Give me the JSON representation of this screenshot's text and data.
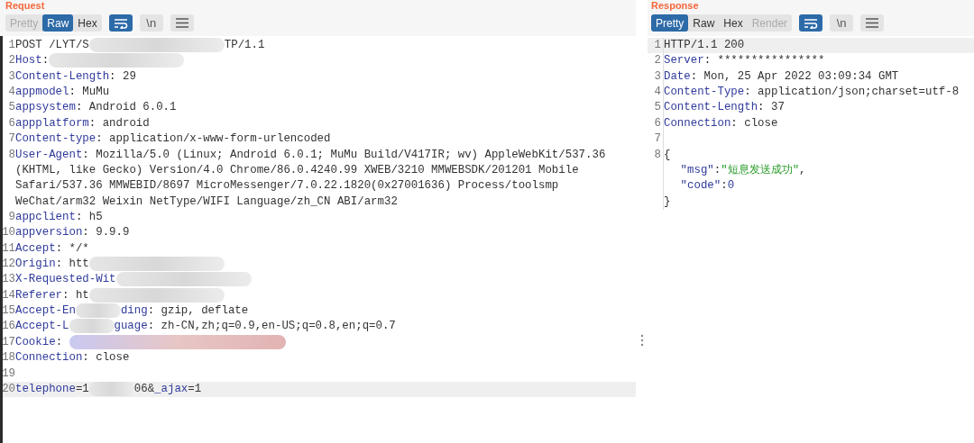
{
  "request": {
    "title": "Request",
    "tabs": [
      {
        "label": "Pretty",
        "selected": false,
        "disabled": true
      },
      {
        "label": "Raw",
        "selected": true,
        "disabled": false
      },
      {
        "label": "Hex",
        "selected": false,
        "disabled": false
      }
    ],
    "tools": [
      {
        "kind": "wrap",
        "on": true
      },
      {
        "kind": "newline",
        "label": "\\n",
        "on": false
      },
      {
        "kind": "menu",
        "on": false
      }
    ],
    "lines": [
      {
        "number": "1",
        "highlighted": false,
        "segments": [
          {
            "kind": "value",
            "text": "POST /LYT/S"
          },
          {
            "kind": "redacted"
          },
          {
            "kind": "value",
            "text": "TP/1.1"
          }
        ]
      },
      {
        "number": "2",
        "highlighted": false,
        "segments": [
          {
            "kind": "key",
            "text": "Host"
          },
          {
            "kind": "value",
            "text": ":"
          },
          {
            "kind": "redacted"
          }
        ]
      },
      {
        "number": "3",
        "highlighted": false,
        "segments": [
          {
            "kind": "key",
            "text": "Content-Length"
          },
          {
            "kind": "value",
            "text": ": 29"
          }
        ]
      },
      {
        "number": "4",
        "highlighted": false,
        "segments": [
          {
            "kind": "key",
            "text": "appmodel"
          },
          {
            "kind": "value",
            "text": ": MuMu"
          }
        ]
      },
      {
        "number": "5",
        "highlighted": false,
        "segments": [
          {
            "kind": "key",
            "text": "appsystem"
          },
          {
            "kind": "value",
            "text": ": Android 6.0.1"
          }
        ]
      },
      {
        "number": "6",
        "highlighted": false,
        "segments": [
          {
            "kind": "key",
            "text": "appplatform"
          },
          {
            "kind": "value",
            "text": ": android"
          }
        ]
      },
      {
        "number": "7",
        "highlighted": false,
        "segments": [
          {
            "kind": "key",
            "text": "Content-type"
          },
          {
            "kind": "value",
            "text": ": application/x-www-form-urlencoded"
          }
        ]
      },
      {
        "number": "8",
        "highlighted": false,
        "segments": [
          {
            "kind": "key",
            "text": "User-Agent"
          },
          {
            "kind": "value",
            "text": ": Mozilla/5.0 (Linux; Android 6.0.1; MuMu Build/V417IR; wv) AppleWebKit/537.36"
          }
        ]
      },
      {
        "highlighted": false,
        "segments": [
          {
            "kind": "value",
            "text": "(KHTML, like Gecko) Version/4.0 Chrome/86.0.4240.99 XWEB/3210 MMWEBSDK/201201 Mobile"
          }
        ]
      },
      {
        "highlighted": false,
        "segments": [
          {
            "kind": "value",
            "text": "Safari/537.36 MMWEBID/8697 MicroMessenger/7.0.22.1820(0x27001636) Process/toolsmp"
          }
        ]
      },
      {
        "highlighted": false,
        "segments": [
          {
            "kind": "value",
            "text": "WeChat/arm32 Weixin NetType/WIFI Language/zh_CN ABI/arm32"
          }
        ]
      },
      {
        "number": "9",
        "highlighted": false,
        "segments": [
          {
            "kind": "key",
            "text": "appclient"
          },
          {
            "kind": "value",
            "text": ": h5"
          }
        ]
      },
      {
        "number": "10",
        "highlighted": false,
        "segments": [
          {
            "kind": "key",
            "text": "appversion"
          },
          {
            "kind": "value",
            "text": ": 9.9.9"
          }
        ]
      },
      {
        "number": "11",
        "highlighted": false,
        "segments": [
          {
            "kind": "key",
            "text": "Accept"
          },
          {
            "kind": "value",
            "text": ": */*"
          }
        ]
      },
      {
        "number": "12",
        "highlighted": false,
        "segments": [
          {
            "kind": "key",
            "text": "Origin"
          },
          {
            "kind": "value",
            "text": ": htt"
          },
          {
            "kind": "redacted"
          }
        ]
      },
      {
        "number": "13",
        "highlighted": false,
        "segments": [
          {
            "kind": "key",
            "text": "X-Requested-Wit"
          },
          {
            "kind": "redacted"
          }
        ]
      },
      {
        "number": "14",
        "highlighted": false,
        "segments": [
          {
            "kind": "key",
            "text": "Referer"
          },
          {
            "kind": "value",
            "text": ": ht"
          },
          {
            "kind": "redacted"
          }
        ]
      },
      {
        "number": "15",
        "highlighted": false,
        "segments": [
          {
            "kind": "key",
            "text": "Accept-En"
          },
          {
            "kind": "redacted-short"
          },
          {
            "kind": "key",
            "text": "ding"
          },
          {
            "kind": "value",
            "text": ": gzip, deflate"
          }
        ]
      },
      {
        "number": "16",
        "highlighted": false,
        "segments": [
          {
            "kind": "key",
            "text": "Accept-L"
          },
          {
            "kind": "redacted-short"
          },
          {
            "kind": "key",
            "text": "guage"
          },
          {
            "kind": "value",
            "text": ": zh-CN,zh;q=0.9,en-US;q=0.8,en;q=0.7"
          }
        ]
      },
      {
        "number": "17",
        "highlighted": false,
        "segments": [
          {
            "kind": "key",
            "text": "Cookie"
          },
          {
            "kind": "value",
            "text": ": "
          },
          {
            "kind": "redacted-long"
          }
        ]
      },
      {
        "number": "18",
        "highlighted": false,
        "segments": [
          {
            "kind": "key",
            "text": "Connection"
          },
          {
            "kind": "value",
            "text": ": close"
          }
        ]
      },
      {
        "number": "19",
        "highlighted": false
      },
      {
        "number": "20",
        "highlighted": true,
        "segments": [
          {
            "kind": "key",
            "text": "telephone"
          },
          {
            "kind": "value",
            "text": "=1"
          },
          {
            "kind": "redacted-short"
          },
          {
            "kind": "value",
            "text": "06&"
          },
          {
            "kind": "key",
            "text": "_ajax"
          },
          {
            "kind": "value",
            "text": "=1"
          }
        ]
      }
    ]
  },
  "response": {
    "title": "Response",
    "tabs": [
      {
        "label": "Pretty",
        "selected": true,
        "disabled": false
      },
      {
        "label": "Raw",
        "selected": false,
        "disabled": false
      },
      {
        "label": "Hex",
        "selected": false,
        "disabled": false
      },
      {
        "label": "Render",
        "selected": false,
        "disabled": true
      }
    ],
    "tools": [
      {
        "kind": "wrap",
        "on": true
      },
      {
        "kind": "newline",
        "label": "\\n",
        "on": false
      },
      {
        "kind": "menu",
        "on": false
      }
    ],
    "lines": [
      {
        "number": "1",
        "highlighted": true,
        "segments": [
          {
            "kind": "value",
            "text": "HTTP/1.1 200"
          }
        ]
      },
      {
        "number": "2",
        "highlighted": false,
        "segments": [
          {
            "kind": "key",
            "text": "Server"
          },
          {
            "kind": "value",
            "text": ": ****************"
          }
        ]
      },
      {
        "number": "3",
        "highlighted": false,
        "segments": [
          {
            "kind": "key",
            "text": "Date"
          },
          {
            "kind": "value",
            "text": ": Mon, 25 Apr 2022 03:09:34 GMT"
          }
        ]
      },
      {
        "number": "4",
        "highlighted": false,
        "segments": [
          {
            "kind": "key",
            "text": "Content-Type"
          },
          {
            "kind": "value",
            "text": ": application/json;charset=utf-8"
          }
        ]
      },
      {
        "number": "5",
        "highlighted": false,
        "segments": [
          {
            "kind": "key",
            "text": "Content-Length"
          },
          {
            "kind": "value",
            "text": ": 37"
          }
        ]
      },
      {
        "number": "6",
        "highlighted": false,
        "segments": [
          {
            "kind": "key",
            "text": "Connection"
          },
          {
            "kind": "value",
            "text": ": close"
          }
        ]
      },
      {
        "number": "7",
        "highlighted": false
      },
      {
        "number": "8",
        "highlighted": false,
        "segments": [
          {
            "kind": "value",
            "text": "{"
          }
        ],
        "children": [
          {
            "highlighted": false,
            "segments": [
              {
                "kind": "key",
                "text": "\"msg\""
              },
              {
                "kind": "value",
                "text": ":"
              },
              {
                "kind": "string",
                "text": "\"短息发送成功\""
              },
              {
                "kind": "value",
                "text": ","
              }
            ]
          },
          {
            "highlighted": false,
            "segments": [
              {
                "kind": "key",
                "text": "\"code\""
              },
              {
                "kind": "value",
                "text": ":"
              },
              {
                "kind": "number",
                "text": "0"
              }
            ]
          }
        ]
      },
      {
        "highlighted": false,
        "segments": [
          {
            "kind": "value",
            "text": "}"
          }
        ]
      }
    ]
  }
}
